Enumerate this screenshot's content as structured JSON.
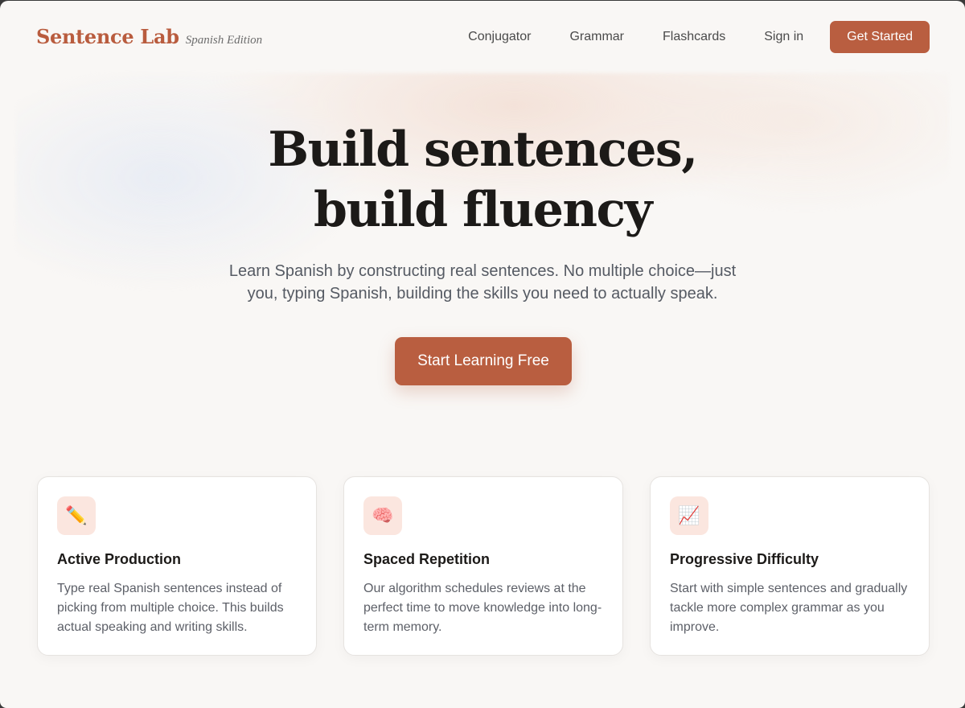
{
  "brand": {
    "name": "Sentence Lab",
    "edition": "Spanish Edition"
  },
  "nav": {
    "links": [
      "Conjugator",
      "Grammar",
      "Flashcards",
      "Sign in"
    ],
    "cta_label": "Get Started"
  },
  "hero": {
    "title_line1": "Build sentences,",
    "title_line2": "build fluency",
    "subtitle": "Learn Spanish by constructing real sentences. No multiple choice—just you, typing Spanish, building the skills you need to actually speak.",
    "cta_label": "Start Learning Free"
  },
  "features": [
    {
      "icon": "pencil-icon",
      "glyph": "✏️",
      "title": "Active Production",
      "description": "Type real Spanish sentences instead of picking from multiple choice. This builds actual speaking and writing skills."
    },
    {
      "icon": "brain-icon",
      "glyph": "🧠",
      "title": "Spaced Repetition",
      "description": "Our algorithm schedules reviews at the perfect time to move knowledge into long-term memory."
    },
    {
      "icon": "chart-increasing-icon",
      "glyph": "📈",
      "title": "Progressive Difficulty",
      "description": "Start with simple sentences and gradually tackle more complex grammar as you improve."
    }
  ],
  "colors": {
    "accent": "#b95e40",
    "background": "#f9f7f5",
    "icon_tile": "#fbe6df",
    "heading": "#1c1a18",
    "body_text": "#5d6068"
  }
}
